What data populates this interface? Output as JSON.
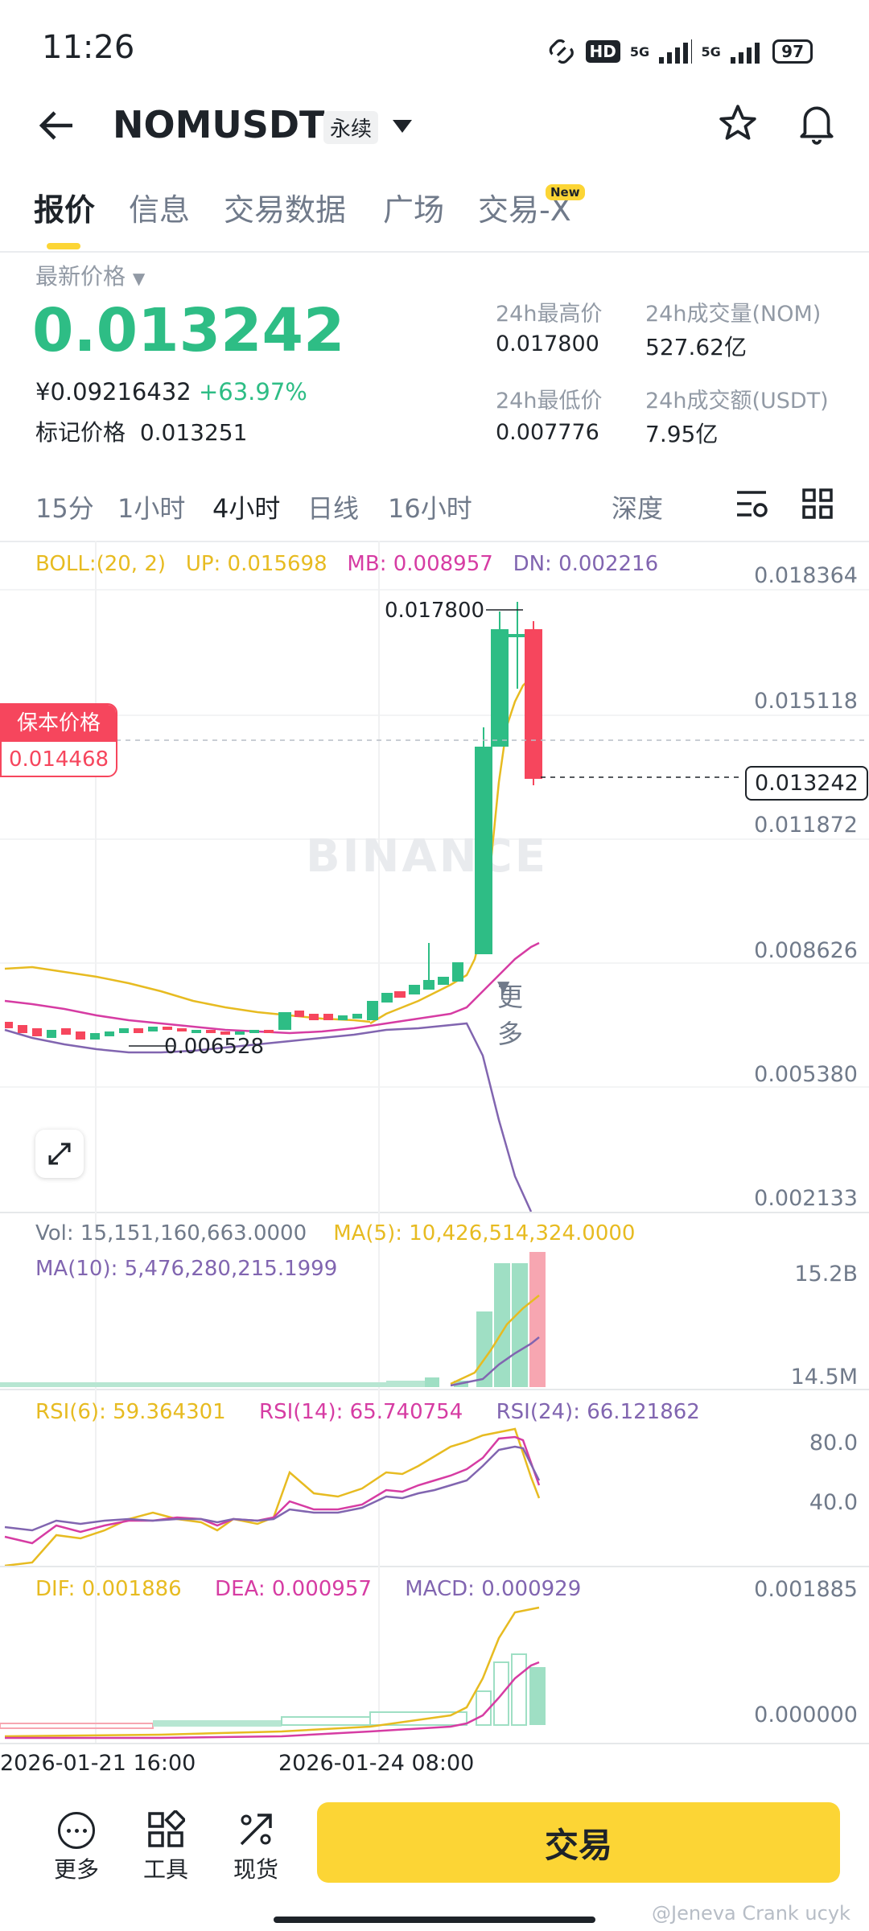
{
  "status_bar": {
    "time": "11:26",
    "hd": "HD",
    "net1": "5G",
    "net2": "5G",
    "battery": "97"
  },
  "header": {
    "symbol": "NOMUSDT",
    "contract_type": "永续"
  },
  "tabs": [
    "报价",
    "信息",
    "交易数据",
    "广场",
    "交易-X"
  ],
  "tab_badge": "New",
  "price": {
    "label": "最新价格",
    "last": "0.013242",
    "cny": "¥0.09216432",
    "change": "+63.97%",
    "mark_label": "标记价格",
    "mark": "0.013251"
  },
  "stats": {
    "high_label": "24h最高价",
    "high": "0.017800",
    "vol_label": "24h成交量(NOM)",
    "vol": "527.62亿",
    "low_label": "24h最低价",
    "low": "0.007776",
    "amt_label": "24h成交额(USDT)",
    "amt": "7.95亿"
  },
  "timeframes": [
    "15分",
    "1小时",
    "4小时",
    "日线",
    "16小时",
    "更多",
    "深度"
  ],
  "selected_timeframe": "4小时",
  "boll": {
    "label": "BOLL:(20, 2)",
    "up": "UP: 0.015698",
    "mb": "MB: 0.008957",
    "dn": "DN: 0.002216"
  },
  "price_axis": [
    "0.018364",
    "0.015118",
    "0.011872",
    "0.008626",
    "0.005380",
    "0.002133"
  ],
  "price_labels": {
    "high_mark": "0.017800",
    "low_mark": "0.006528",
    "current": "0.013242"
  },
  "breakeven": {
    "label": "保本价格",
    "value": "0.014468"
  },
  "watermark": "BINANCE",
  "volume": {
    "vol": "Vol: 15,151,160,663.0000",
    "ma5": "MA(5): 10,426,514,324.0000",
    "ma10": "MA(10): 5,476,280,215.1999",
    "axis_top": "15.2B",
    "axis_bottom": "14.5M"
  },
  "rsi": {
    "rsi6": "RSI(6): 59.364301",
    "rsi14": "RSI(14): 65.740754",
    "rsi24": "RSI(24): 66.121862",
    "axis_top": "80.0",
    "axis_bottom": "40.0"
  },
  "macd": {
    "dif": "DIF: 0.001886",
    "dea": "DEA: 0.000957",
    "macd": "MACD: 0.000929",
    "axis_top": "0.001885",
    "axis_bottom": "0.000000"
  },
  "dates": [
    "2026-01-21 16:00",
    "2026-01-24 08:00"
  ],
  "bottom_nav": {
    "more": "更多",
    "tools": "工具",
    "spot": "现货",
    "trade": "交易"
  },
  "credit": "@Jeneva Crank ucyk",
  "colors": {
    "up": "#2ebd85",
    "down": "#f6465d",
    "boll_up": "#e7bb21",
    "boll_mb": "#d63ca3",
    "boll_dn": "#8165b0",
    "accent": "#fcd535"
  }
}
